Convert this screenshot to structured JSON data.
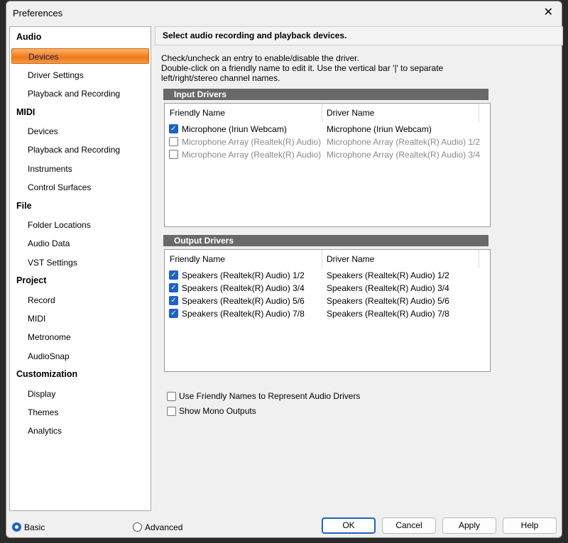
{
  "window": {
    "title": "Preferences",
    "close": "✕"
  },
  "sidebar": [
    {
      "type": "cat",
      "label": "Audio"
    },
    {
      "type": "item",
      "label": "Devices",
      "selected": true
    },
    {
      "type": "item",
      "label": "Driver Settings"
    },
    {
      "type": "item",
      "label": "Playback and Recording"
    },
    {
      "type": "cat",
      "label": "MIDI"
    },
    {
      "type": "item",
      "label": "Devices"
    },
    {
      "type": "item",
      "label": "Playback and Recording"
    },
    {
      "type": "item",
      "label": "Instruments"
    },
    {
      "type": "item",
      "label": "Control Surfaces"
    },
    {
      "type": "cat",
      "label": "File"
    },
    {
      "type": "item",
      "label": "Folder Locations"
    },
    {
      "type": "item",
      "label": "Audio Data"
    },
    {
      "type": "item",
      "label": "VST Settings"
    },
    {
      "type": "cat",
      "label": "Project"
    },
    {
      "type": "item",
      "label": "Record"
    },
    {
      "type": "item",
      "label": "MIDI"
    },
    {
      "type": "item",
      "label": "Metronome"
    },
    {
      "type": "item",
      "label": "AudioSnap"
    },
    {
      "type": "cat",
      "label": "Customization"
    },
    {
      "type": "item",
      "label": "Display"
    },
    {
      "type": "item",
      "label": "Themes"
    },
    {
      "type": "item",
      "label": "Analytics"
    }
  ],
  "main": {
    "header": "Select audio recording and playback devices.",
    "desc1": "Check/uncheck an entry to enable/disable the driver.",
    "desc2": "Double-click on a friendly name to edit it. Use the vertical bar '|' to separate left/right/stereo channel names.",
    "col_friendly": "Friendly Name",
    "col_driver": "Driver Name",
    "input_title": "Input Drivers",
    "inputs": [
      {
        "friendly": "Microphone (Iriun Webcam)",
        "driver": "Microphone (Iriun Webcam)",
        "checked": true
      },
      {
        "friendly": "Microphone Array (Realtek(R) Audio) ...",
        "driver": "Microphone Array (Realtek(R) Audio) 1/2",
        "checked": false
      },
      {
        "friendly": "Microphone Array (Realtek(R) Audio) ...",
        "driver": "Microphone Array (Realtek(R) Audio) 3/4",
        "checked": false
      }
    ],
    "output_title": "Output Drivers",
    "outputs": [
      {
        "friendly": "Speakers (Realtek(R) Audio) 1/2",
        "driver": "Speakers (Realtek(R) Audio) 1/2",
        "checked": true
      },
      {
        "friendly": "Speakers (Realtek(R) Audio) 3/4",
        "driver": "Speakers (Realtek(R) Audio) 3/4",
        "checked": true
      },
      {
        "friendly": "Speakers (Realtek(R) Audio) 5/6",
        "driver": "Speakers (Realtek(R) Audio) 5/6",
        "checked": true
      },
      {
        "friendly": "Speakers (Realtek(R) Audio) 7/8",
        "driver": "Speakers (Realtek(R) Audio) 7/8",
        "checked": true
      }
    ],
    "opt_friendly": "Use Friendly Names to Represent Audio Drivers",
    "opt_mono": "Show Mono Outputs"
  },
  "footer": {
    "basic": "Basic",
    "advanced": "Advanced",
    "mode": "basic",
    "ok": "OK",
    "cancel": "Cancel",
    "apply": "Apply",
    "help": "Help"
  },
  "colors": {
    "accent": "#1f62c4",
    "selection": "#f07a16"
  }
}
